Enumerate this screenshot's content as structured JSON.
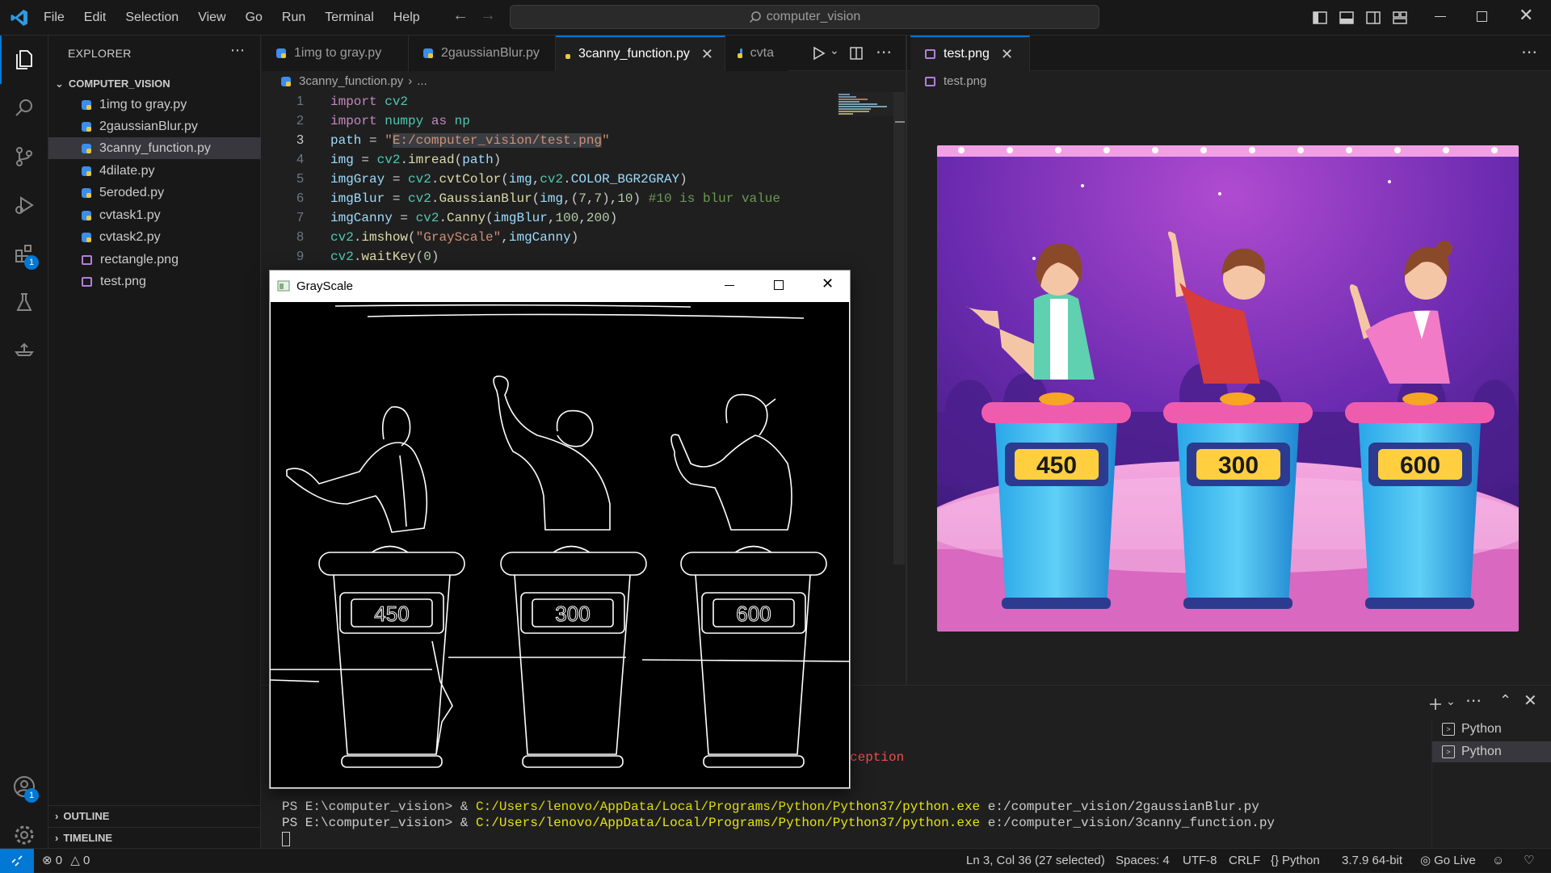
{
  "menu": [
    "File",
    "Edit",
    "Selection",
    "View",
    "Go",
    "Run",
    "Terminal",
    "Help"
  ],
  "search": {
    "text": "computer_vision"
  },
  "explorer": {
    "title": "EXPLORER",
    "folder": "COMPUTER_VISION",
    "files": [
      {
        "name": "1img to gray.py",
        "type": "py"
      },
      {
        "name": "2gaussianBlur.py",
        "type": "py"
      },
      {
        "name": "3canny_function.py",
        "type": "py",
        "selected": true
      },
      {
        "name": "4dilate.py",
        "type": "py"
      },
      {
        "name": "5eroded.py",
        "type": "py"
      },
      {
        "name": "cvtask1.py",
        "type": "py"
      },
      {
        "name": "cvtask2.py",
        "type": "py"
      },
      {
        "name": "rectangle.png",
        "type": "png"
      },
      {
        "name": "test.png",
        "type": "png"
      }
    ],
    "outline": "OUTLINE",
    "timeline": "TIMELINE"
  },
  "activity_badges": {
    "extensions": "1",
    "accounts": "1"
  },
  "editor1": {
    "tabs": [
      "1img to gray.py",
      "2gaussianBlur.py",
      "3canny_function.py",
      "cvta"
    ],
    "active_tab": "3canny_function.py",
    "breadcrumb": "3canny_function.py",
    "breadcrumb_more": "...",
    "line_numbers": [
      "1",
      "2",
      "3",
      "4",
      "5",
      "6",
      "7",
      "8",
      "9"
    ],
    "code": [
      "import cv2",
      "import numpy as np",
      "path = \"E:/computer_vision/test.png\"",
      "img = cv2.imread(path)",
      "imgGray = cv2.cvtColor(img,cv2.COLOR_BGR2GRAY)",
      "imgBlur = cv2.GaussianBlur(img,(7,7),10) #10 is blur value",
      "imgCanny = cv2.Canny(imgBlur,100,200)",
      "cv2.imshow(\"GrayScale\",imgCanny)",
      "cv2.waitKey(0)"
    ]
  },
  "editor2": {
    "tab": "test.png",
    "breadcrumb": "test.png",
    "scores": [
      "450",
      "300",
      "600"
    ]
  },
  "gray_window": {
    "title": "GrayScale",
    "scores": [
      "450",
      "300",
      "600"
    ]
  },
  "panel": {
    "exception_fragment": "ception",
    "terminal_lines": [
      {
        "prompt": "PS E:\\computer_vision> & ",
        "exe": "C:/Users/lenovo/AppData/Local/Programs/Python/Python37/python.exe",
        "arg": " e:/computer_vision/2gaussianBlur.py"
      },
      {
        "prompt": "PS E:\\computer_vision> & ",
        "exe": "C:/Users/lenovo/AppData/Local/Programs/Python/Python37/python.exe",
        "arg": " e:/computer_vision/3canny_function.py"
      }
    ],
    "terminals": [
      "Python",
      "Python"
    ]
  },
  "status": {
    "errors": "0",
    "warnings": "0",
    "cursor": "Ln 3, Col 36 (27 selected)",
    "spaces": "Spaces: 4",
    "encoding": "UTF-8",
    "eol": "CRLF",
    "language": "Python",
    "interpreter": "3.7.9 64-bit",
    "golive": "Go Live"
  },
  "colors": {
    "accent": "#0078d4",
    "bg": "#1f1f1f",
    "sidebar": "#181818"
  }
}
